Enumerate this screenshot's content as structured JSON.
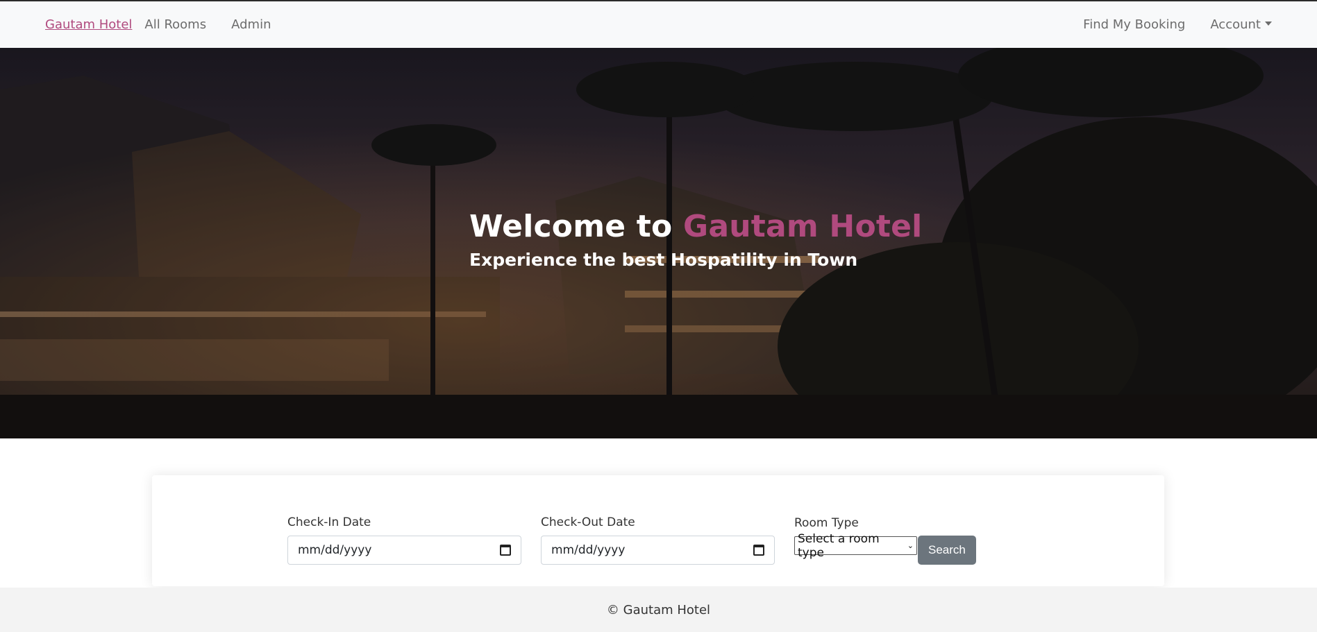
{
  "navbar": {
    "brand": "Gautam Hotel",
    "links": [
      "All Rooms",
      "Admin"
    ],
    "find_booking": "Find My Booking",
    "account": "Account"
  },
  "hero": {
    "title_prefix": "Welcome to ",
    "title_accent": "Gautam Hotel",
    "subtitle": "Experience the best Hospatility in Town"
  },
  "booking": {
    "checkin_label": "Check-In Date",
    "checkin_placeholder": "mm/dd/yyyy",
    "checkout_label": "Check-Out Date",
    "checkout_placeholder": "mm/dd/yyyy",
    "roomtype_label": "Room Type",
    "roomtype_selected": "Select a room type",
    "search_label": "Search"
  },
  "footer": {
    "text": "© Gautam Hotel"
  },
  "colors": {
    "accent": "#b04a7e",
    "button": "#6c757d",
    "navbar_bg": "#f8f9fa",
    "footer_bg": "#f3f3f3"
  }
}
